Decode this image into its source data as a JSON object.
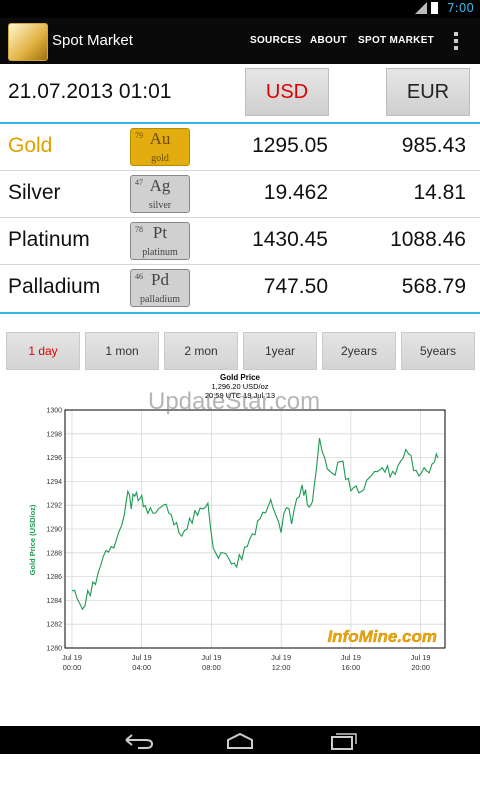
{
  "status_bar": {
    "time": "7:00",
    "signal_label": "3G"
  },
  "action_bar": {
    "title": "Spot Market",
    "menu": [
      "SOURCES",
      "ABOUT",
      "SPOT MARKET"
    ]
  },
  "header": {
    "datetime": "21.07.2013 01:01",
    "currencies": [
      "USD",
      "EUR"
    ],
    "selected_currency": "USD"
  },
  "metals": [
    {
      "name": "Gold",
      "number": "79",
      "symbol": "Au",
      "element": "gold",
      "usd": "1295.05",
      "eur": "985.43"
    },
    {
      "name": "Silver",
      "number": "47",
      "symbol": "Ag",
      "element": "silver",
      "usd": "19.462",
      "eur": "14.81"
    },
    {
      "name": "Platinum",
      "number": "78",
      "symbol": "Pt",
      "element": "platinum",
      "usd": "1430.45",
      "eur": "1088.46"
    },
    {
      "name": "Palladium",
      "number": "46",
      "symbol": "Pd",
      "element": "palladium",
      "usd": "747.50",
      "eur": "568.79"
    }
  ],
  "ranges": [
    "1 day",
    "1 mon",
    "2 mon",
    "1year",
    "2years",
    "5years"
  ],
  "active_range": "1 day",
  "watermark": "UpdateStar.com",
  "chart_data": {
    "type": "line",
    "title": "Gold Price",
    "subtitle_price": "1,296.20 USD/oz",
    "subtitle_time": "20:59 UTC 19 Jul '13",
    "ylabel": "Gold Price (USD/oz)",
    "xlabel": "",
    "ylim": [
      1280,
      1300
    ],
    "y_ticks": [
      "1280",
      "1282",
      "1284",
      "1286",
      "1288",
      "1290",
      "1292",
      "1294",
      "1296",
      "1298",
      "1300"
    ],
    "x_ticks": [
      {
        "hour": 0,
        "label1": "Jul 19",
        "label2": "00:00"
      },
      {
        "hour": 4,
        "label1": "Jul 19",
        "label2": "04:00"
      },
      {
        "hour": 8,
        "label1": "Jul 19",
        "label2": "08:00"
      },
      {
        "hour": 12,
        "label1": "Jul 19",
        "label2": "12:00"
      },
      {
        "hour": 16,
        "label1": "Jul 19",
        "label2": "16:00"
      },
      {
        "hour": 20,
        "label1": "Jul 19",
        "label2": "20:00"
      }
    ],
    "brand": "InfoMine.com",
    "line_color": "#1a9a50",
    "series": [
      {
        "x": [
          0,
          0.3,
          0.6,
          0.9,
          1.2,
          1.5,
          1.8,
          2.1,
          2.4,
          2.7,
          3.0,
          3.2,
          3.4,
          3.6,
          3.8,
          4.0,
          4.2,
          4.5,
          4.8,
          5.1,
          5.4,
          5.7,
          6.0,
          6.3,
          6.6,
          6.9,
          7.2,
          7.5,
          7.8,
          8.1,
          8.4,
          8.7,
          9.0,
          9.3,
          9.6,
          9.9,
          10.2,
          10.5,
          10.8,
          11.1,
          11.4,
          11.7,
          12.0,
          12.3,
          12.6,
          12.9,
          13.2,
          13.4,
          13.6,
          13.8,
          14.0,
          14.2,
          14.5,
          14.8,
          15.1,
          15.4,
          15.7,
          16.0,
          16.3,
          16.6,
          16.9,
          17.2,
          17.5,
          17.8,
          18.1,
          18.4,
          18.7,
          19.0,
          19.3,
          19.6,
          19.9,
          20.2,
          20.5,
          20.8,
          21.0
        ],
        "y": [
          1284.8,
          1284.0,
          1283.0,
          1284.5,
          1285.2,
          1286.0,
          1287.5,
          1288.0,
          1288.5,
          1290.0,
          1291.5,
          1293.5,
          1292.0,
          1293.0,
          1292.5,
          1292.8,
          1291.8,
          1291.5,
          1291.0,
          1291.5,
          1291.8,
          1291.0,
          1290.5,
          1289.5,
          1290.2,
          1290.8,
          1291.5,
          1292.0,
          1292.4,
          1288.5,
          1287.5,
          1287.8,
          1287.2,
          1286.8,
          1287.5,
          1288.2,
          1289.0,
          1289.5,
          1291.0,
          1291.6,
          1292.8,
          1291.5,
          1290.0,
          1292.0,
          1290.5,
          1292.5,
          1293.5,
          1293.0,
          1291.5,
          1292.0,
          1294.5,
          1297.5,
          1296.0,
          1295.0,
          1294.8,
          1296.0,
          1294.5,
          1293.5,
          1293.8,
          1293.2,
          1294.0,
          1294.3,
          1294.5,
          1294.8,
          1295.0,
          1294.6,
          1295.2,
          1296.0,
          1296.5,
          1295.2,
          1294.8,
          1295.5,
          1295.0,
          1295.8,
          1296.0
        ]
      }
    ]
  }
}
